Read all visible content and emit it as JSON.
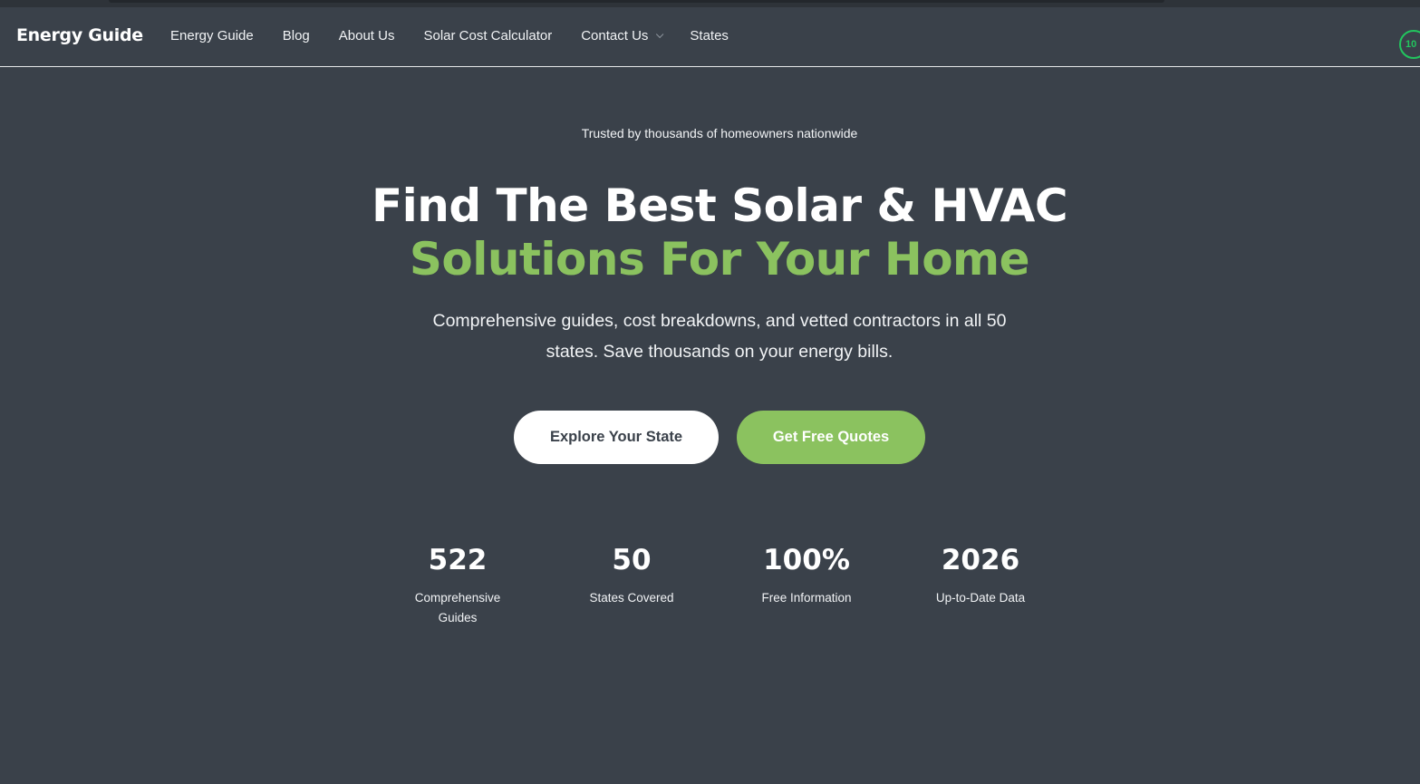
{
  "nav": {
    "brand": "Energy Guide",
    "links": [
      "Energy Guide",
      "Blog",
      "About Us",
      "Solar Cost Calculator",
      "Contact Us",
      "States"
    ],
    "badge": "10"
  },
  "hero": {
    "kicker": "Trusted by thousands of homeowners nationwide",
    "title_line1": "Find The Best Solar & HVAC",
    "title_line2": "Solutions For Your Home",
    "subtitle": "Comprehensive guides, cost breakdowns, and vetted contractors in all 50 states. Save thousands on your energy bills.",
    "primary_button": "Explore Your State",
    "secondary_button": "Get Free Quotes"
  },
  "stats": [
    {
      "value": "522",
      "label": "Comprehensive Guides"
    },
    {
      "value": "50",
      "label": "States Covered"
    },
    {
      "value": "100%",
      "label": "Free Information"
    },
    {
      "value": "2026",
      "label": "Up-to-Date Data"
    }
  ],
  "colors": {
    "background": "#3a414a",
    "accent": "#8bc25f",
    "badge": "#22c55e"
  }
}
